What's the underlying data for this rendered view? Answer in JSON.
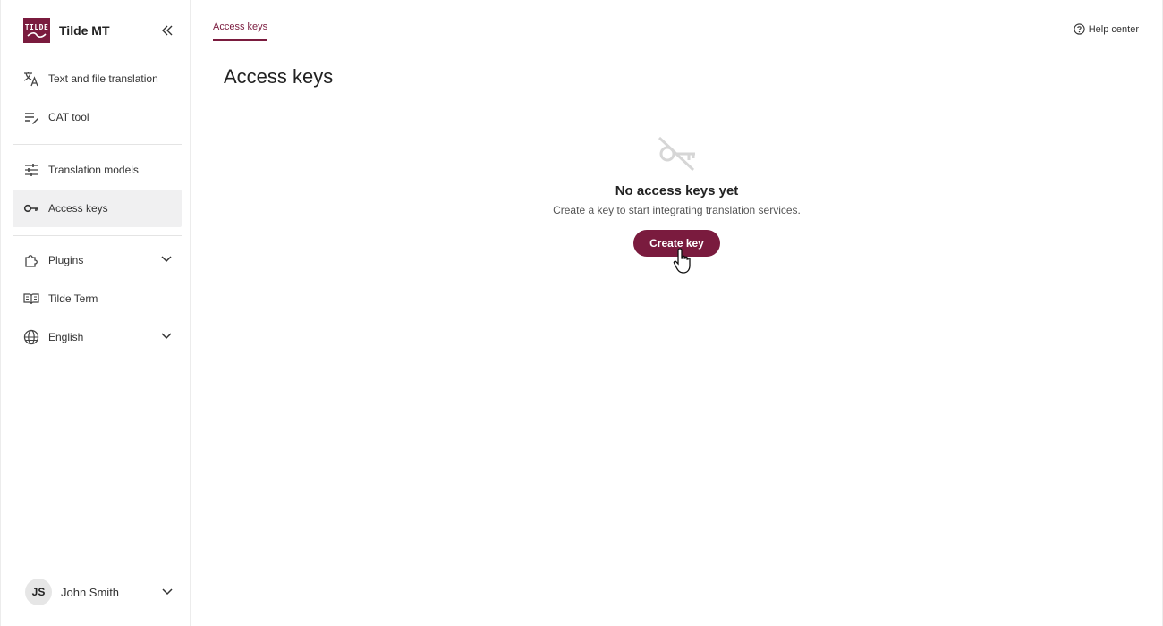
{
  "brand": {
    "logo_text_1": "TILDE",
    "name": "Tilde MT"
  },
  "sidebar": {
    "items": [
      {
        "label": "Text and file translation",
        "icon": "translate-icon"
      },
      {
        "label": "CAT tool",
        "icon": "edit-list-icon"
      },
      {
        "label": "Translation models",
        "icon": "tune-icon"
      },
      {
        "label": "Access keys",
        "icon": "key-icon",
        "active": true
      },
      {
        "label": "Plugins",
        "icon": "puzzle-icon"
      },
      {
        "label": "Tilde Term",
        "icon": "book-icon"
      },
      {
        "label": "English",
        "icon": "globe-icon"
      }
    ]
  },
  "user": {
    "initials": "JS",
    "name": "John Smith"
  },
  "header": {
    "tab": "Access keys",
    "help": "Help center"
  },
  "main": {
    "title": "Access keys",
    "empty_title": "No access keys yet",
    "empty_subtitle": "Create a key to start integrating translation services.",
    "create_button": "Create key"
  },
  "colors": {
    "accent": "#7a1b3e",
    "active_bg": "#f0f0f1"
  }
}
